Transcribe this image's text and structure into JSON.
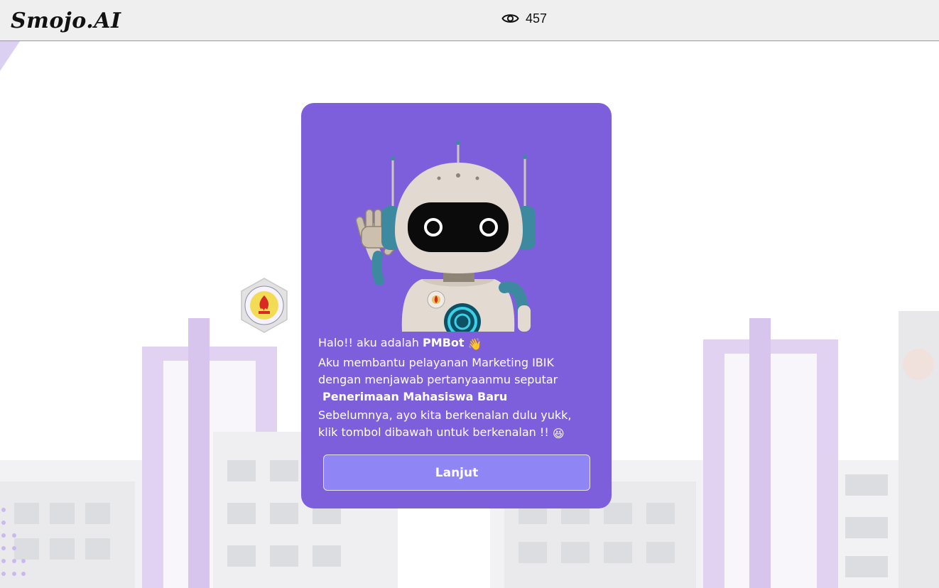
{
  "header": {
    "logo_text": "Smojo.AI",
    "views_icon": "eye-icon",
    "views_count": "457"
  },
  "card": {
    "greeting_prefix": "Halo!! aku adalah",
    "bot_name": "PMBot",
    "wave_emoji": "👋",
    "line1": "Aku membantu pelayanan Marketing IBIK",
    "line2": "dengan menjawab pertanyaanmu seputar",
    "topic": "Penerimaan Mahasiswa Baru",
    "line3": "Sebelumnya, ayo kita berkenalan dulu yukk,",
    "line4": "klik tombol dibawah untuk berkenalan !!",
    "laugh_emoji": "😆",
    "button_label": "Lanjut"
  },
  "colors": {
    "card_bg": "#7e5fdb",
    "button_bg": "#8f85f5",
    "topbar_bg": "#efefef"
  }
}
